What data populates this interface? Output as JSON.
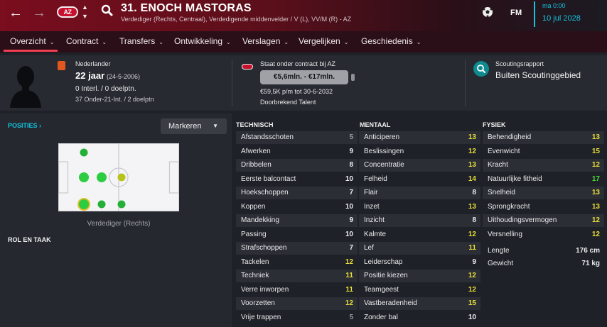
{
  "header": {
    "club_badge": "AZ",
    "title": "31. ENOCH MASTORAS",
    "subtitle": "Verdediger (Rechts, Centraal), Verdedigende middenvelder / V (L), VV/M (R) - AZ",
    "fm_label": "FM",
    "time": "ma 0:00",
    "date": "10 jul 2028"
  },
  "tabs": [
    "Overzicht",
    "Contract",
    "Transfers",
    "Ontwikkeling",
    "Verslagen",
    "Vergelijken",
    "Geschiedenis"
  ],
  "profile": {
    "nationality": "Nederlander",
    "age": "22 jaar",
    "dob": "(24-5-2006)",
    "caps": "0 Interl. / 0 doelptn.",
    "u21": "37 Onder-21-Int. / 2 doelptn"
  },
  "contract": {
    "label": "Staat onder contract bij AZ",
    "value_range": "€5,6mln. - €17mln.",
    "wage": "€59,5K p/m tot 30-6-2032",
    "talent": "Doorbrekend Talent"
  },
  "scouting": {
    "title": "Scoutingsrapport",
    "status": "Buiten Scoutinggebied"
  },
  "positions": {
    "heading": "POSITIES",
    "markeren": "Markeren",
    "caption": "Verdediger (Rechts)",
    "role_heading": "ROL EN TAAK",
    "dot_colors": {
      "natural": "#2ecc40",
      "competent": "#24b036",
      "partial": "#b7c318",
      "selected_ring": "#e3c12a"
    }
  },
  "colors": {
    "white": "#ececee",
    "grey": "#9a9ca1",
    "yellow": "#e8dd3a",
    "green": "#4fd63a"
  },
  "technisch": {
    "heading": "TECHNISCH",
    "rows": [
      {
        "name": "Afstandsschoten",
        "value": "5"
      },
      {
        "name": "Afwerken",
        "value": "9"
      },
      {
        "name": "Dribbelen",
        "value": "8"
      },
      {
        "name": "Eerste balcontact",
        "value": "10"
      },
      {
        "name": "Hoekschoppen",
        "value": "7"
      },
      {
        "name": "Koppen",
        "value": "10"
      },
      {
        "name": "Mandekking",
        "value": "9"
      },
      {
        "name": "Passing",
        "value": "10"
      },
      {
        "name": "Strafschoppen",
        "value": "7"
      },
      {
        "name": "Tackelen",
        "value": "12"
      },
      {
        "name": "Techniek",
        "value": "11"
      },
      {
        "name": "Verre inworpen",
        "value": "11"
      },
      {
        "name": "Voorzetten",
        "value": "12"
      },
      {
        "name": "Vrije trappen",
        "value": "5"
      }
    ]
  },
  "mentaal": {
    "heading": "MENTAAL",
    "rows": [
      {
        "name": "Anticiperen",
        "value": "13"
      },
      {
        "name": "Beslissingen",
        "value": "12"
      },
      {
        "name": "Concentratie",
        "value": "13"
      },
      {
        "name": "Felheid",
        "value": "14"
      },
      {
        "name": "Flair",
        "value": "8"
      },
      {
        "name": "Inzet",
        "value": "13"
      },
      {
        "name": "Inzicht",
        "value": "8"
      },
      {
        "name": "Kalmte",
        "value": "12"
      },
      {
        "name": "Lef",
        "value": "11"
      },
      {
        "name": "Leiderschap",
        "value": "9"
      },
      {
        "name": "Positie kiezen",
        "value": "12"
      },
      {
        "name": "Teamgeest",
        "value": "12"
      },
      {
        "name": "Vastberadenheid",
        "value": "15"
      },
      {
        "name": "Zonder bal",
        "value": "10"
      }
    ]
  },
  "fysiek": {
    "heading": "FYSIEK",
    "rows": [
      {
        "name": "Behendigheid",
        "value": "13"
      },
      {
        "name": "Evenwicht",
        "value": "15"
      },
      {
        "name": "Kracht",
        "value": "12"
      },
      {
        "name": "Natuurlijke fitheid",
        "value": "17"
      },
      {
        "name": "Snelheid",
        "value": "13"
      },
      {
        "name": "Sprongkracht",
        "value": "13"
      },
      {
        "name": "Uithoudingsvermogen",
        "value": "12"
      },
      {
        "name": "Versnelling",
        "value": "12"
      }
    ],
    "lengte_label": "Lengte",
    "lengte": "176 cm",
    "gewicht_label": "Gewicht",
    "gewicht": "71 kg"
  }
}
